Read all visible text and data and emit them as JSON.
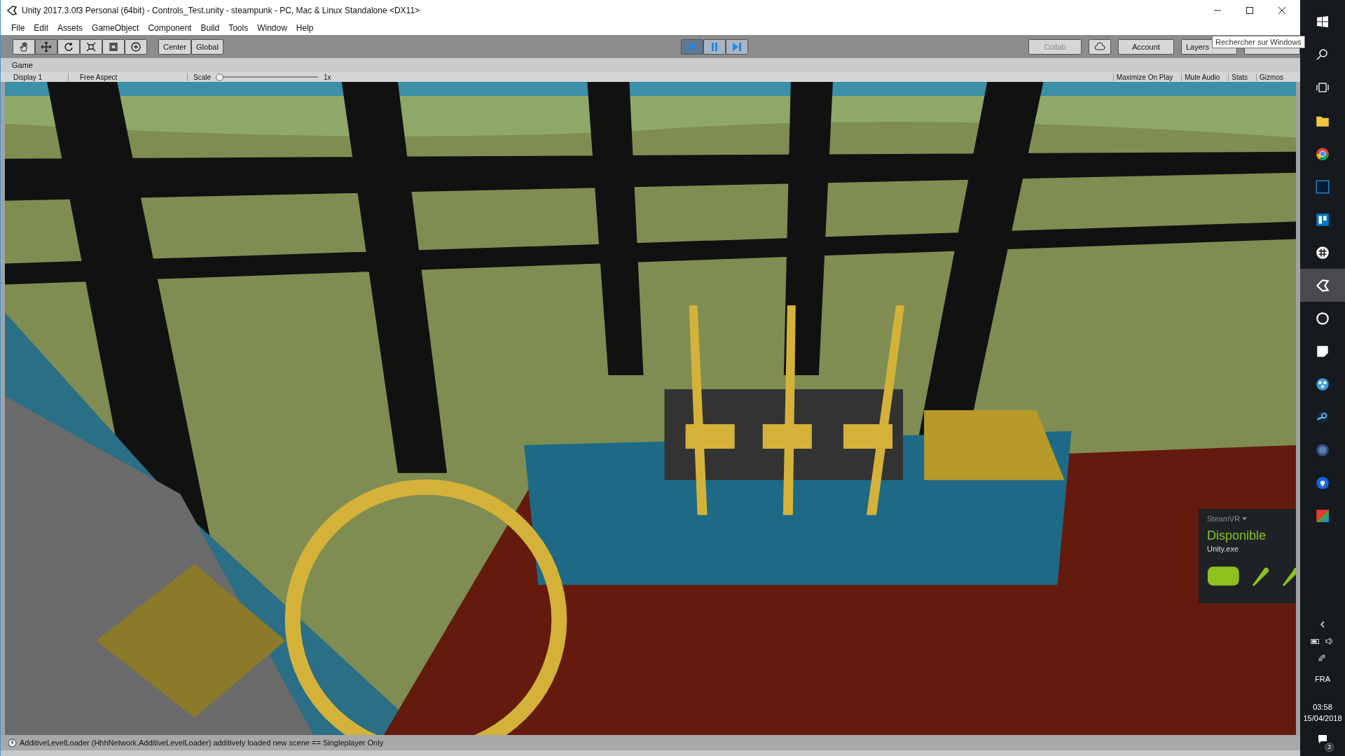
{
  "window": {
    "title": "Unity 2017.3.0f3 Personal (64bit) - Controls_Test.unity - steampunk - PC, Mac & Linux Standalone <DX11>"
  },
  "menu": [
    "File",
    "Edit",
    "Assets",
    "GameObject",
    "Component",
    "Build",
    "Tools",
    "Window",
    "Help"
  ],
  "toolbar": {
    "tools": [
      {
        "kind": "hand",
        "selected": false
      },
      {
        "kind": "move",
        "selected": true
      },
      {
        "kind": "rotate",
        "selected": false
      },
      {
        "kind": "scale",
        "selected": false
      },
      {
        "kind": "rect",
        "selected": false
      },
      {
        "kind": "transform",
        "selected": false
      }
    ],
    "pivot": [
      "Center",
      "Global"
    ],
    "play": [
      {
        "kind": "play",
        "on": true
      },
      {
        "kind": "pause",
        "on": false
      },
      {
        "kind": "step",
        "on": false
      }
    ],
    "collab": "Collab",
    "account": "Account",
    "layers": "Layers"
  },
  "tooltip": "Rechercher sur Windows",
  "game_panel": {
    "tab": "Game",
    "display": "Display 1",
    "aspect": "Free Aspect",
    "scale_label": "Scale",
    "scale": {
      "level": 0
    },
    "scale_reading": "1x",
    "options": [
      "Maximize On Play",
      "Mute Audio",
      "Stats",
      "Gizmos"
    ]
  },
  "status_bar": "AdditiveLevelLoader (HhhNetwork.AdditiveLevelLoader) additively loaded new scene == Singleplayer Only",
  "steamvr": {
    "title": "SteamVR",
    "status": "Disponible",
    "app": "Unity.exe"
  },
  "taskbar": {
    "apps": [
      {
        "kind": "folder",
        "selected": false
      },
      {
        "kind": "chrome",
        "selected": false
      },
      {
        "kind": "ps",
        "selected": false
      },
      {
        "kind": "board",
        "selected": false
      },
      {
        "kind": "hash",
        "selected": false
      },
      {
        "kind": "unity",
        "selected": true
      },
      {
        "kind": "unreal",
        "selected": false
      },
      {
        "kind": "note",
        "selected": false
      },
      {
        "kind": "dots",
        "selected": false
      },
      {
        "kind": "steam",
        "selected": false
      },
      {
        "kind": "vr",
        "selected": false
      },
      {
        "kind": "pin",
        "selected": false
      },
      {
        "kind": "gradient",
        "selected": false
      }
    ],
    "language": "FRA",
    "time": "03:58",
    "date": "15/04/2018",
    "notifications": "3"
  }
}
